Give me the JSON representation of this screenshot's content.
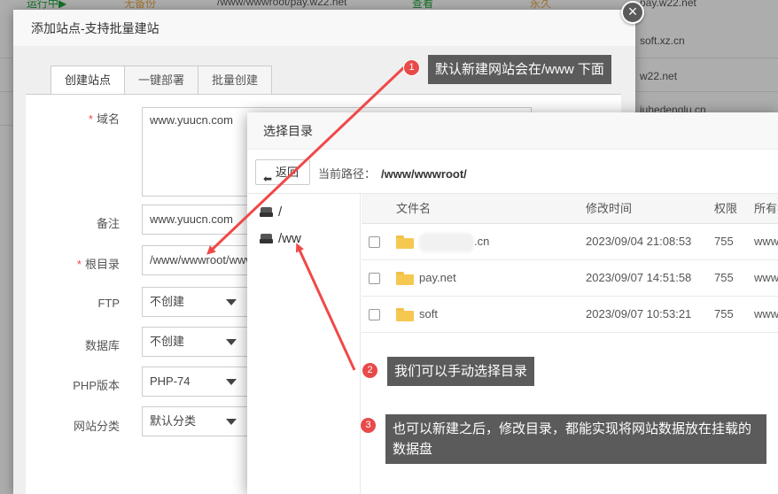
{
  "background": {
    "top_strip": [
      "运行中▶",
      "无备份",
      "/www/wwwroot/pay.w22.net",
      "查看",
      "永久",
      "pay.w22.net"
    ],
    "domains": [
      "soft.xz.cn",
      "w22.net",
      "juhedenglu.cn"
    ]
  },
  "main_dialog": {
    "title": "添加站点-支持批量建站",
    "tabs": [
      "创建站点",
      "一键部署",
      "批量创建"
    ],
    "fields": {
      "domain_label": "域名",
      "domain_value": "www.yuucn.com",
      "remark_label": "备注",
      "remark_value": "www.yuucn.com",
      "root_label": "根目录",
      "root_value": "/www/wwwroot/www",
      "ftp_label": "FTP",
      "ftp_value": "不创建",
      "db_label": "数据库",
      "db_value": "不创建",
      "php_label": "PHP版本",
      "php_value": "PHP-74",
      "category_label": "网站分类",
      "category_value": "默认分类"
    }
  },
  "dir_dialog": {
    "title": "选择目录",
    "back_label": "返回",
    "path_label": "当前路径：",
    "path_value": "/www/wwwroot/",
    "tree": [
      {
        "label": "/"
      },
      {
        "label": "/ww"
      }
    ],
    "columns": [
      "文件名",
      "修改时间",
      "权限",
      "所有者"
    ],
    "rows": [
      {
        "name": ".cn",
        "mtime": "2023/09/04 21:08:53",
        "perm": "755",
        "owner": "www"
      },
      {
        "name": "pay.net",
        "mtime": "2023/09/07 14:51:58",
        "perm": "755",
        "owner": "www"
      },
      {
        "name": "soft",
        "mtime": "2023/09/07 10:53:21",
        "perm": "755",
        "owner": "www"
      }
    ]
  },
  "callouts": [
    {
      "num": "1",
      "text": "默认新建网站会在/www  下面"
    },
    {
      "num": "2",
      "text": "我们可以手动选择目录"
    },
    {
      "num": "3",
      "text": "也可以新建之后，修改目录，都能实现将网站数据放在挂载的数据盘"
    }
  ],
  "colors": {
    "badge": "#e84a4a",
    "callout_bg": "#5b5b5b",
    "arrow": "#f04848",
    "folder": "#f5c852"
  }
}
